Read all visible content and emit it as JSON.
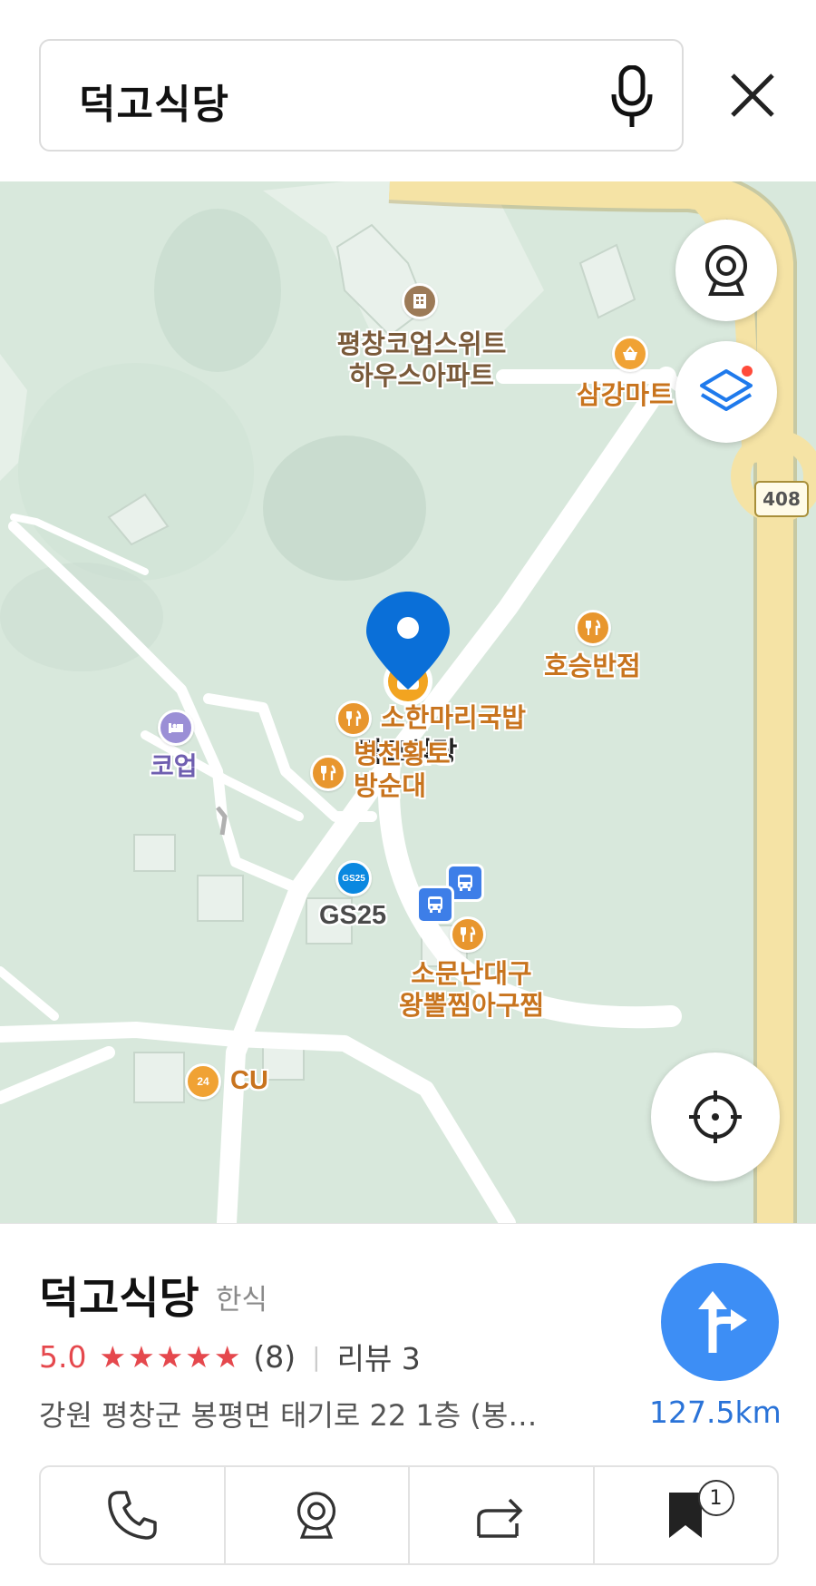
{
  "search": {
    "query": "덕고식당",
    "mic_icon": "mic-icon",
    "close_icon": "close-icon"
  },
  "map": {
    "route_number": "408",
    "pois": [
      {
        "id": "pyeongchang-apt",
        "name_line1": "평창코업스위트",
        "name_line2": "하우스아파트",
        "icon": "building-icon"
      },
      {
        "id": "samgang-mart",
        "name": "삼강마트",
        "icon": "basket-icon"
      },
      {
        "id": "hoseung",
        "name": "호승반점",
        "icon": "restaurant-icon"
      },
      {
        "id": "selected",
        "name": "덕고식당",
        "icon": "restaurant-icon"
      },
      {
        "id": "sohan",
        "name": "소한마리국밥",
        "icon": "restaurant-icon"
      },
      {
        "id": "byeongcheon",
        "name_line1": "병천황토",
        "name_line2": "방순대",
        "icon": "restaurant-icon"
      },
      {
        "id": "coop",
        "name": "코업",
        "icon": "bed-icon"
      },
      {
        "id": "gs25",
        "name": "GS25",
        "icon": "gs25-icon"
      },
      {
        "id": "somunnan",
        "name_line1": "소문난대구",
        "name_line2": "왕뽈찜아구찜",
        "icon": "restaurant-icon"
      },
      {
        "id": "cu",
        "name": "CU",
        "icon": "convenience-icon"
      }
    ],
    "gs25_logo_text": "GS25",
    "cu_logo_text": "24",
    "buttons": {
      "cctv_icon": "cctv-icon",
      "layers_icon": "layers-icon",
      "locate_icon": "crosshair-icon"
    }
  },
  "place": {
    "name": "덕고식당",
    "category": "한식",
    "rating": "5.0",
    "stars": "★★★★★",
    "rating_count": "(8)",
    "separator": "|",
    "review_label": "리뷰 3",
    "address": "강원 평창군 봉평면 태기로 22 1층 (봉…",
    "distance": "127.5km"
  },
  "actions": [
    {
      "name": "call",
      "icon": "phone-icon"
    },
    {
      "name": "cctv",
      "icon": "cctv-icon"
    },
    {
      "name": "share",
      "icon": "share-icon"
    },
    {
      "name": "save",
      "icon": "bookmark-icon",
      "badge": "1"
    }
  ],
  "colors": {
    "accent_blue": "#3d8ef5",
    "marker_blue": "#0a6fd8",
    "rating_red": "#e5484d",
    "map_green": "#d8e8dc",
    "road_yellow": "#f5e3a5",
    "poi_orange": "#e8962e"
  }
}
